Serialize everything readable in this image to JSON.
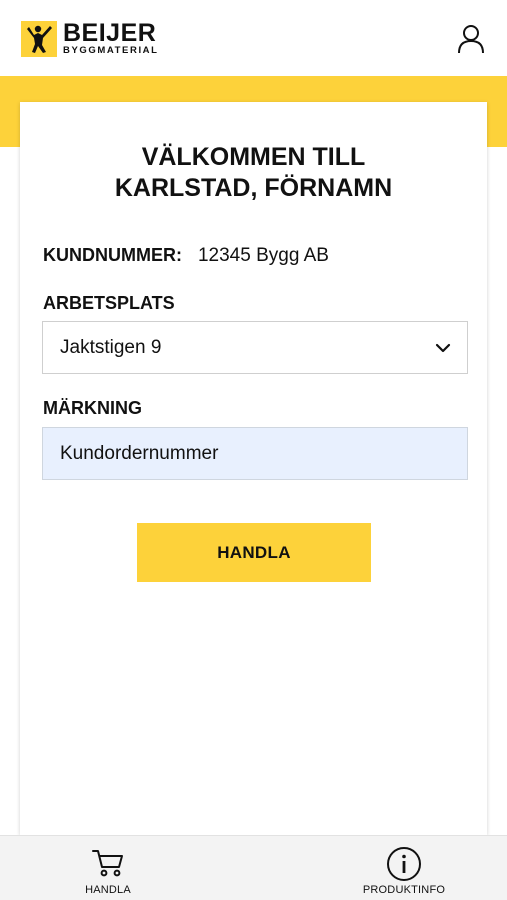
{
  "brand": {
    "name": "BEIJER",
    "subtitle": "BYGGMATERIAL",
    "color": "#fdd23a"
  },
  "icons": {
    "user": "user-icon",
    "chevron": "chevron-down-icon",
    "cart": "cart-icon",
    "info": "info-icon"
  },
  "welcome": {
    "line1": "VÄLKOMMEN TILL",
    "line2": "KARLSTAD, FÖRNAMN"
  },
  "customer": {
    "label": "KUNDNUMMER:",
    "value": "12345 Bygg AB"
  },
  "worksite": {
    "label": "ARBETSPLATS",
    "selected": "Jaktstigen 9"
  },
  "marking": {
    "label": "MÄRKNING",
    "value": "Kundordernummer"
  },
  "actions": {
    "shop_label": "HANDLA"
  },
  "bottom_nav": {
    "items": [
      {
        "label": "HANDLA",
        "icon": "cart-icon"
      },
      {
        "label": "PRODUKTINFO",
        "icon": "info-icon"
      }
    ]
  }
}
